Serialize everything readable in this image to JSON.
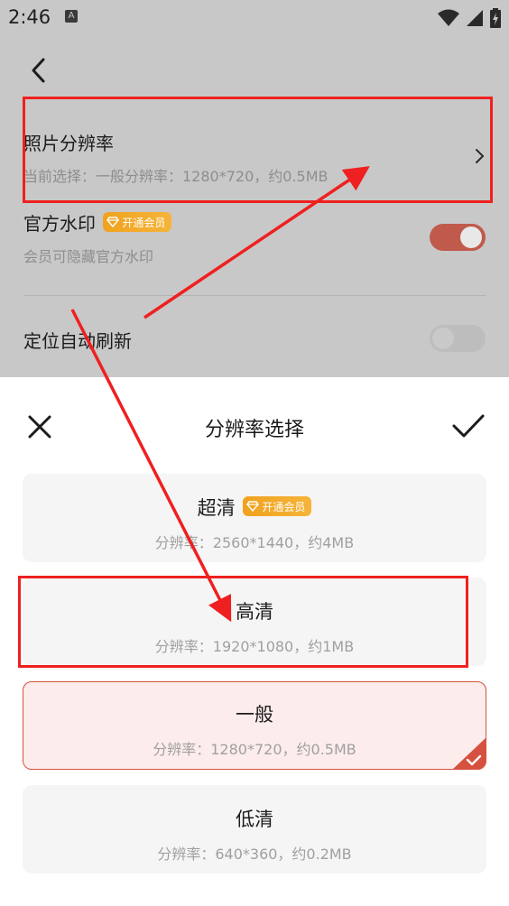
{
  "status_bar": {
    "time": "2:46",
    "notification_icon_label": "A"
  },
  "settings": {
    "resolution": {
      "title": "照片分辨率",
      "subtitle": "当前选择：一般分辨率：1280*720，约0.5MB"
    },
    "watermark": {
      "title": "官方水印",
      "vip_badge": "开通会员",
      "subtitle": "会员可隐藏官方水印",
      "toggle_on": true
    },
    "location": {
      "title": "定位自动刷新",
      "toggle_on": false
    }
  },
  "sheet": {
    "title": "分辨率选择",
    "options": [
      {
        "name": "超清",
        "vip_badge": "开通会员",
        "desc": "分辨率：2560*1440，约4MB",
        "selected": false
      },
      {
        "name": "高清",
        "desc": "分辨率：1920*1080，约1MB",
        "selected": false
      },
      {
        "name": "一般",
        "desc": "分辨率：1280*720，约0.5MB",
        "selected": true
      },
      {
        "name": "低清",
        "desc": "分辨率：640*360，约0.2MB",
        "selected": false
      }
    ]
  },
  "colors": {
    "accent": "#d6513f",
    "vip_gold": "#f0a21e",
    "annotation_red": "#ef2020"
  }
}
